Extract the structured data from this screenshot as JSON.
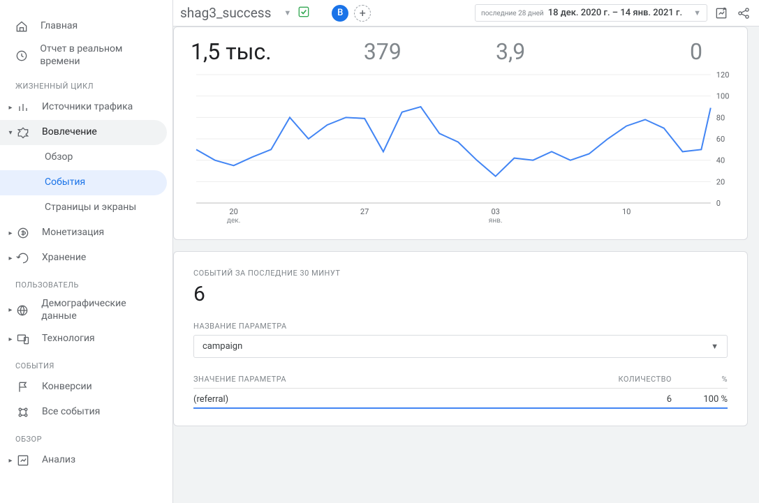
{
  "sidebar": {
    "home": "Главная",
    "realtime": "Отчет в реальном времени",
    "sections": {
      "lifecycle": "ЖИЗНЕННЫЙ ЦИКЛ",
      "user": "ПОЛЬЗОВАТЕЛЬ",
      "events": "СОБЫТИЯ",
      "overview": "ОБЗОР"
    },
    "traffic": "Источники трафика",
    "engagement": "Вовлечение",
    "engagement_sub": {
      "overview": "Обзор",
      "events": "События",
      "pages": "Страницы и экраны"
    },
    "monetization": "Монетизация",
    "retention": "Хранение",
    "demographics": "Демографические данные",
    "technology": "Технология",
    "conversions": "Конверсии",
    "all_events": "Все события",
    "analysis": "Анализ"
  },
  "header": {
    "event_name": "shag3_success",
    "avatar_letter": "В",
    "date_prefix": "последние 28 дней",
    "date_range": "18 дек. 2020 г. – 14 янв. 2021 г."
  },
  "metrics": {
    "m1": "1,5 тыс.",
    "m2": "379",
    "m3": "3,9",
    "m4": "0"
  },
  "chart_data": {
    "type": "line",
    "xlabel": "",
    "ylabel": "",
    "ylim": [
      0,
      120
    ],
    "y_ticks": [
      0,
      20,
      40,
      60,
      80,
      100,
      120
    ],
    "x_ticks": [
      {
        "pos": 2,
        "label": "20",
        "sub": "дек."
      },
      {
        "pos": 9,
        "label": "27",
        "sub": ""
      },
      {
        "pos": 16,
        "label": "03",
        "sub": "янв."
      },
      {
        "pos": 23,
        "label": "10",
        "sub": ""
      }
    ],
    "x": [
      0,
      1,
      2,
      3,
      4,
      5,
      6,
      7,
      8,
      9,
      10,
      11,
      12,
      13,
      14,
      15,
      16,
      17,
      18,
      19,
      20,
      21,
      22,
      23,
      24,
      25,
      26,
      27
    ],
    "values": [
      50,
      40,
      35,
      43,
      50,
      80,
      60,
      73,
      80,
      79,
      48,
      85,
      90,
      65,
      57,
      40,
      25,
      42,
      40,
      48,
      40,
      46,
      60,
      72,
      78,
      70,
      48,
      50
    ]
  },
  "chart_tail_value": 89,
  "events30": {
    "title": "СОБЫТИЙ ЗА ПОСЛЕДНИЕ 30 МИНУТ",
    "count": "6",
    "param_name_label": "НАЗВАНИЕ ПАРАМЕТРА",
    "param_selected": "campaign",
    "table": {
      "headers": {
        "name": "ЗНАЧЕНИЕ ПАРАМЕТРА",
        "count": "КОЛИЧЕСТВО",
        "pct": "%"
      },
      "rows": [
        {
          "name": "(referral)",
          "count": "6",
          "pct": "100 %"
        }
      ]
    }
  }
}
